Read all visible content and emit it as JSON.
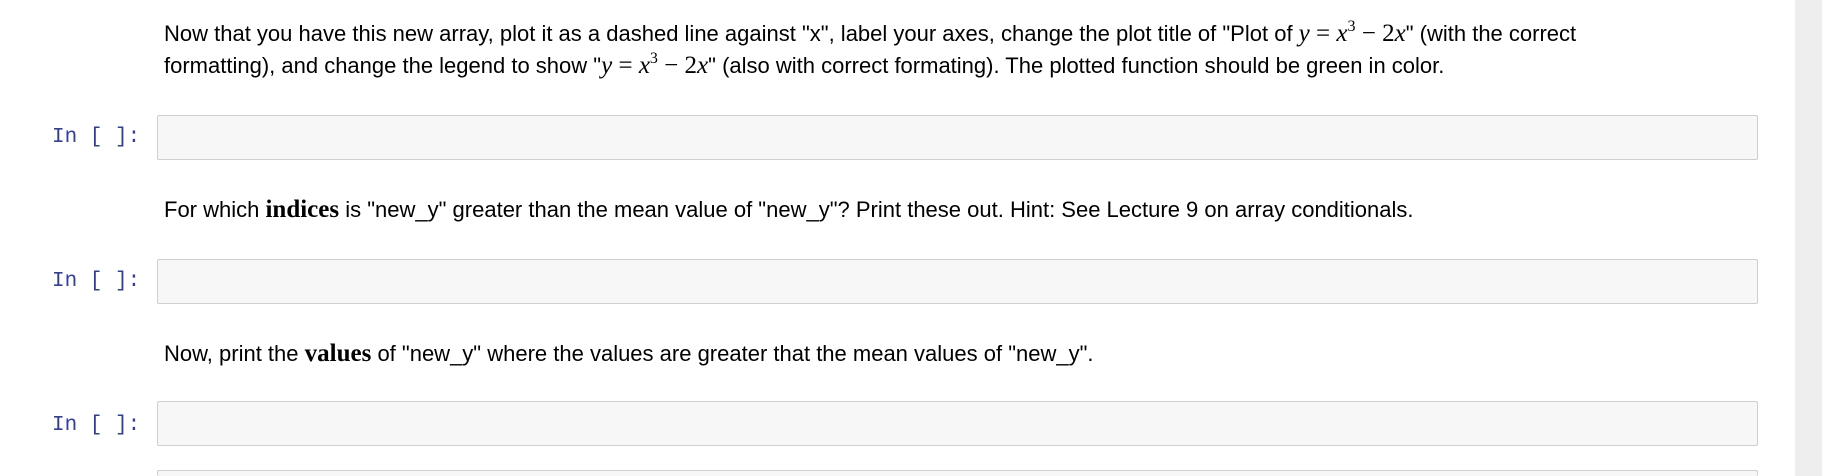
{
  "cells": [
    {
      "kind": "markdown",
      "line1_text": "Now that you have this new array, plot it as a dashed line against \"x\", label your axes, change the plot title of \"Plot of ",
      "line1_math_y": "y",
      "line1_math_eq": " = ",
      "line1_math_x": "x",
      "line1_math_exp": "3",
      "line1_math_minus": " − 2",
      "line1_math_x2": "x",
      "line1_tail": "\" (with the correct",
      "line2_text": "formatting), and change the legend to show \"",
      "line2_math_y": "y",
      "line2_math_eq": " = ",
      "line2_math_x": "x",
      "line2_math_exp": "3",
      "line2_math_minus": " − 2",
      "line2_math_x2": "x",
      "line2_tail": "\" (also with correct formating). The plotted function should be green in color."
    },
    {
      "kind": "code",
      "prompt": "In [ ]:",
      "source": ""
    },
    {
      "kind": "markdown",
      "before": "For which ",
      "bold": "indices",
      "after": " is \"new_y\" greater than the mean value of \"new_y\"? Print these out. Hint: See Lecture 9 on array conditionals."
    },
    {
      "kind": "code",
      "prompt": "In [ ]:",
      "source": ""
    },
    {
      "kind": "markdown",
      "before": "Now, print the ",
      "bold": "values",
      "after": " of \"new_y\" where the values are greater that the mean values of \"new_y\"."
    },
    {
      "kind": "code",
      "prompt": "In [ ]:",
      "source": ""
    }
  ],
  "colors": {
    "prompt": "#303f9f",
    "cell_background": "#f7f7f7",
    "cell_border": "#cfcfcf",
    "scroll_gutter": "#eeeeee"
  }
}
